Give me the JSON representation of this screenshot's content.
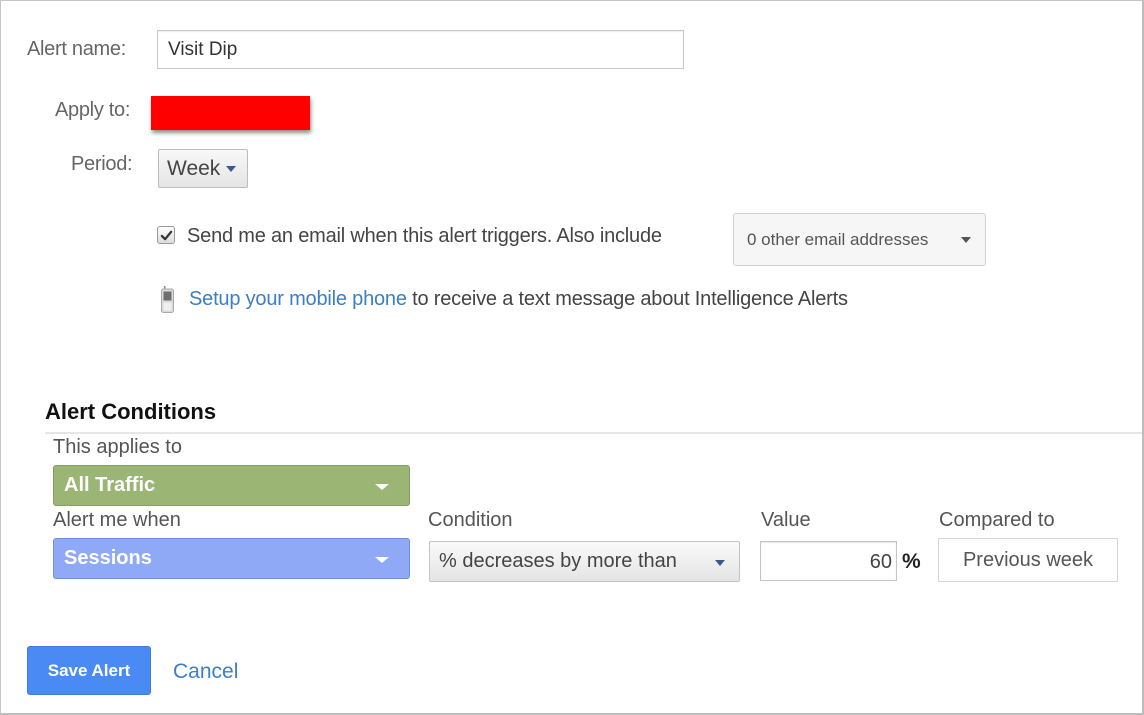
{
  "form": {
    "alert_name": {
      "label": "Alert name:",
      "value": "Visit Dip"
    },
    "apply_to": {
      "label": "Apply to:",
      "value_redacted": true,
      "redaction_color": "#ff0000"
    },
    "period": {
      "label": "Period:",
      "selected": "Week"
    },
    "email": {
      "checked": true,
      "text": "Send me an email when this alert triggers. Also include",
      "addresses_select": "0 other email addresses"
    },
    "mobile": {
      "icon": "mobile-phone-icon",
      "link_text": "Setup your mobile phone",
      "rest_text": " to receive a text message about Intelligence Alerts"
    }
  },
  "conditions": {
    "title": "Alert Conditions",
    "applies_to": {
      "label": "This applies to",
      "selected": "All Traffic",
      "color": "#9bb574"
    },
    "alert_me_when": {
      "label": "Alert me when",
      "selected": "Sessions",
      "color": "#8fa9f7"
    },
    "condition": {
      "label": "Condition",
      "selected": "% decreases by more than"
    },
    "value": {
      "label": "Value",
      "value": "60",
      "unit": "%"
    },
    "compared_to": {
      "label": "Compared to",
      "value": "Previous week"
    }
  },
  "actions": {
    "save_label": "Save Alert",
    "save_color": "#4a8af4",
    "cancel_label": "Cancel",
    "link_color": "#3b7fc4"
  }
}
